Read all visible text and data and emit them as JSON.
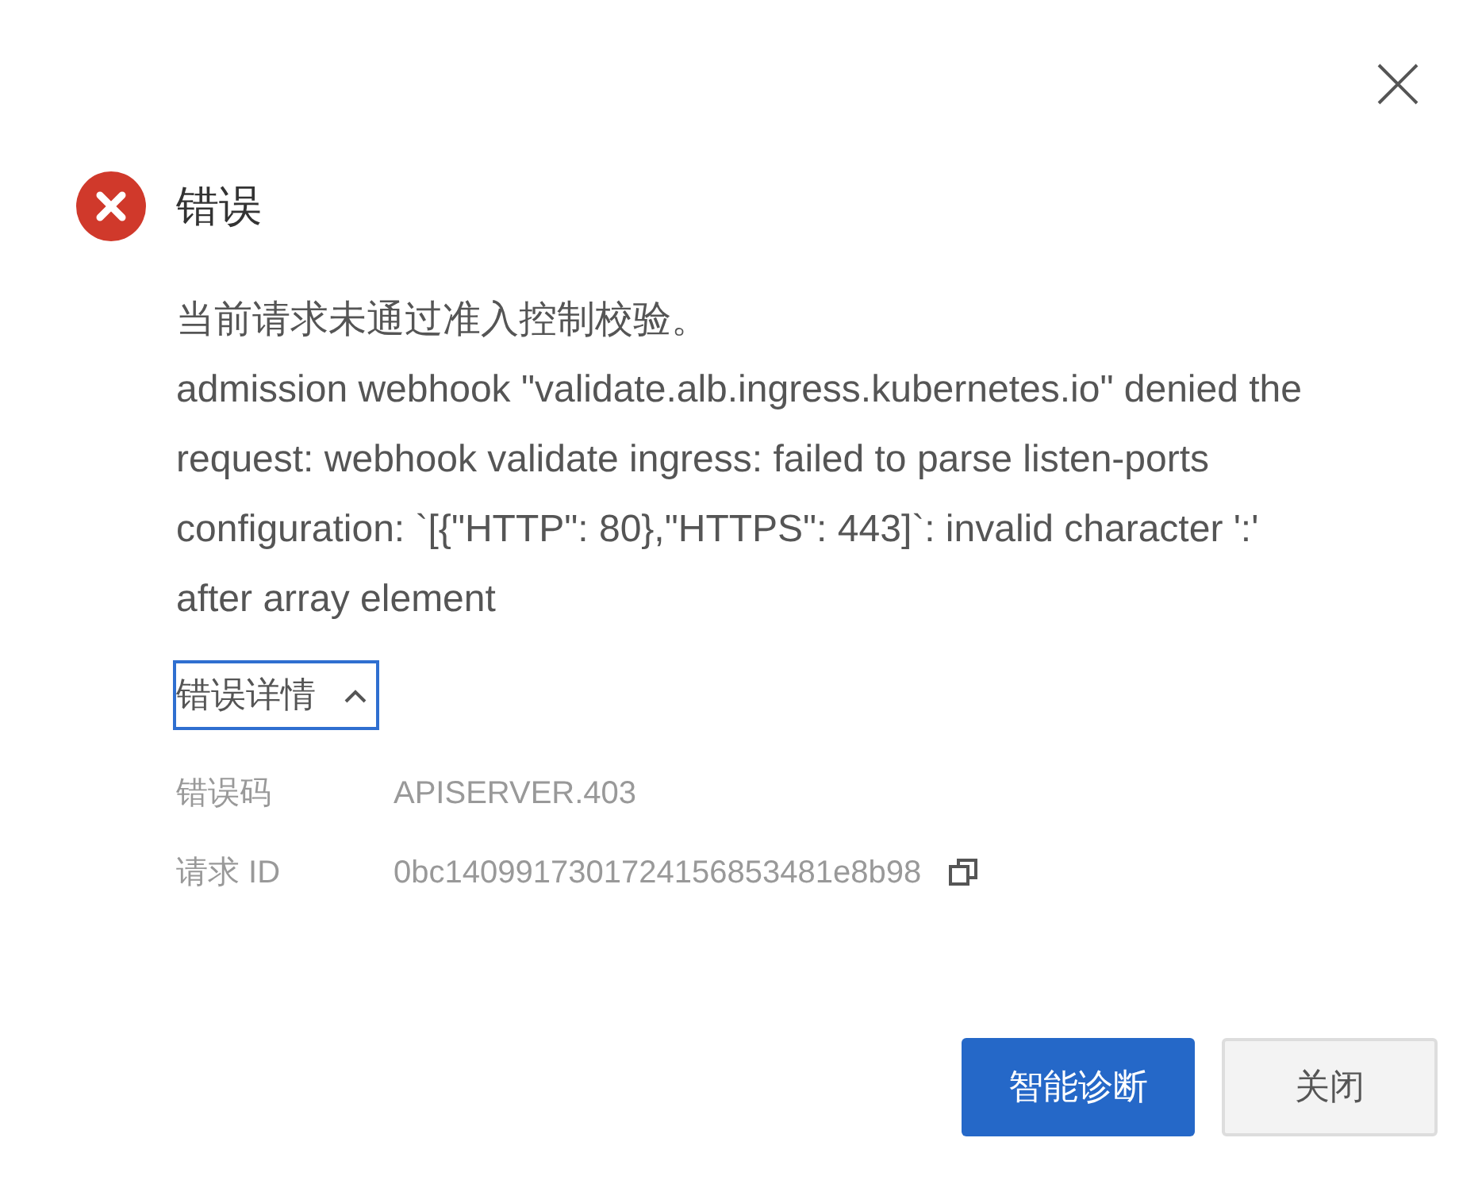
{
  "dialog": {
    "title": "错误",
    "summary": "当前请求未通过准入控制校验。",
    "message": "admission webhook \"validate.alb.ingress.kubernetes.io\" denied the request: webhook validate ingress: failed to parse listen-ports configuration: `[{\"HTTP\": 80},\"HTTPS\": 443]`: invalid character ':' after array element",
    "details_toggle": {
      "label": "错误详情",
      "expanded": true
    },
    "details": [
      {
        "label": "错误码",
        "value": "APISERVER.403",
        "copyable": false
      },
      {
        "label": "请求 ID",
        "value": "0bc1409917301724156853481e8b98",
        "copyable": true
      }
    ],
    "buttons": [
      {
        "label": "智能诊断",
        "kind": "primary"
      },
      {
        "label": "关闭",
        "kind": "secondary"
      }
    ]
  }
}
